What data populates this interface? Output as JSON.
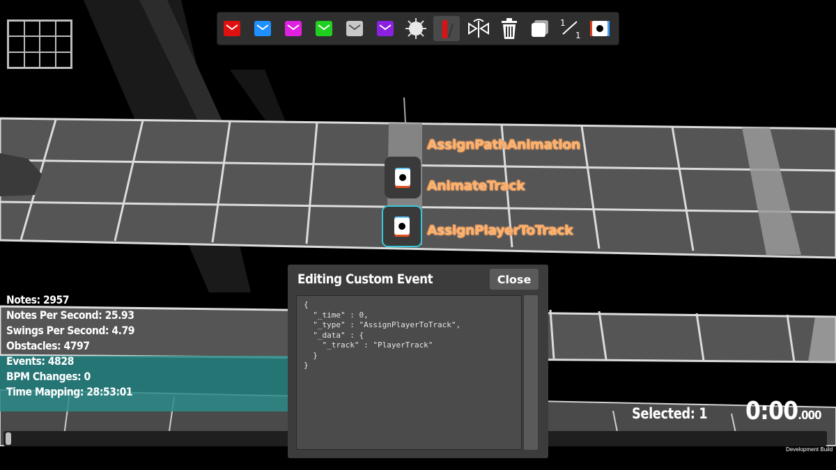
{
  "toolbar": {
    "tools": [
      {
        "name": "red-note-icon",
        "color": "#e01010"
      },
      {
        "name": "blue-note-icon",
        "color": "#1e90ff"
      },
      {
        "name": "magenta-note-icon",
        "color": "#e020e0"
      },
      {
        "name": "green-note-icon",
        "color": "#20d020"
      },
      {
        "name": "white-note-icon",
        "color": "#c8c8c8"
      },
      {
        "name": "purple-note-icon",
        "color": "#8a20e0"
      },
      {
        "name": "bomb-icon"
      },
      {
        "name": "wall-icon",
        "color": "#e01010"
      },
      {
        "name": "mirror-icon"
      },
      {
        "name": "trash-icon"
      },
      {
        "name": "copy-icon"
      },
      {
        "name": "precision-icon"
      },
      {
        "name": "event-icon"
      }
    ],
    "precision_top": "1",
    "precision_bottom": "1"
  },
  "events": [
    {
      "label": "AssignPathAnimation"
    },
    {
      "label": "AnimateTrack"
    },
    {
      "label": "AssignPlayerToTrack"
    }
  ],
  "stats": {
    "notes": "Notes: 2957",
    "nps": "Notes Per Second: 25.93",
    "sps": "Swings Per Second: 4.79",
    "obstacles": "Obstacles: 4797",
    "events": "Events: 4828",
    "bpm": "BPM Changes: 0",
    "time_mapping": "Time Mapping: 28:53:01"
  },
  "dialog": {
    "title": "Editing Custom Event",
    "close_label": "Close",
    "json_text": "{\n  \"_time\" : 0,\n  \"_type\" : \"AssignPlayerToTrack\",\n  \"_data\" : {\n    \"_track\" : \"PlayerTrack\"\n  }\n}"
  },
  "status": {
    "selected": "Selected: 1",
    "time_main": "0:00",
    "time_ms": ".000",
    "dev_build": "Development Build"
  }
}
